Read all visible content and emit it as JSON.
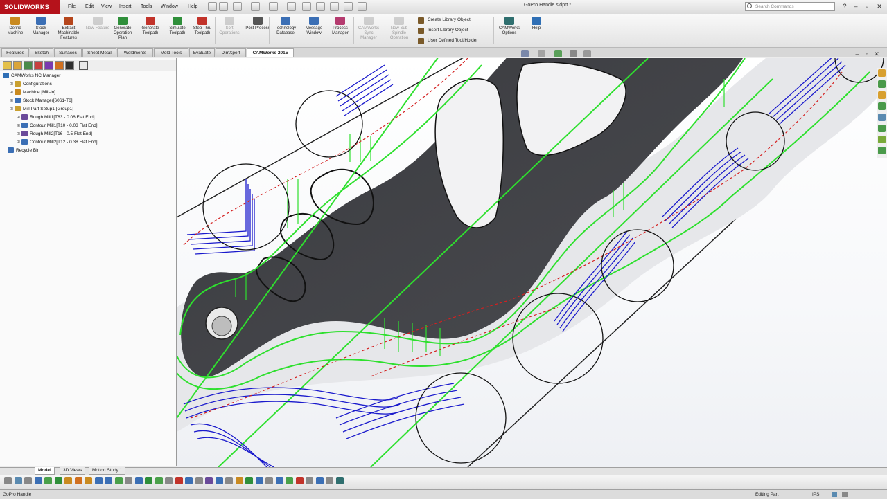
{
  "app": {
    "logo": "SOLIDWORKS",
    "doc_title": "GoPro Handle.sldprt *"
  },
  "menu": [
    "File",
    "Edit",
    "View",
    "Insert",
    "Tools",
    "Window",
    "Help"
  ],
  "search": {
    "placeholder": "Search Commands"
  },
  "window_buttons": [
    "?",
    "–",
    "▫",
    "✕"
  ],
  "commands": [
    {
      "label": "Define Machine",
      "color": "#c98a20",
      "disabled": false
    },
    {
      "label": "Stock Manager",
      "color": "#3b6fb5",
      "disabled": false
    },
    {
      "label": "Extract Machinable Features",
      "color": "#b5451b",
      "disabled": false
    },
    {
      "label": "New Feature",
      "color": "#888888",
      "disabled": true
    },
    {
      "label": "Generate Operation Plan",
      "color": "#2f8f3a",
      "disabled": false
    },
    {
      "label": "Generate Toolpath",
      "color": "#c2332a",
      "disabled": false
    },
    {
      "label": "Simulate Toolpath",
      "color": "#2f8f3a",
      "disabled": false
    },
    {
      "label": "Step Thru Toolpath",
      "color": "#c2332a",
      "disabled": false
    },
    {
      "label": "Sort Operations",
      "color": "#888888",
      "disabled": true
    },
    {
      "label": "Post Process",
      "color": "#555555",
      "disabled": false
    },
    {
      "label": "Technology Database",
      "color": "#3b6fb5",
      "disabled": false
    },
    {
      "label": "Message Window",
      "color": "#3b6fb5",
      "disabled": false
    },
    {
      "label": "Process Manager",
      "color": "#b53b6f",
      "disabled": false
    },
    {
      "label": "CAMWorks Sync Manager",
      "color": "#888888",
      "disabled": true
    },
    {
      "label": "New Sub Spindle Operation",
      "color": "#888888",
      "disabled": true
    }
  ],
  "library": [
    "Create Library Object",
    "Insert Library Object",
    "User Defined Tool/Holder"
  ],
  "commands_right": [
    {
      "label": "CAMWorks Options",
      "color": "#2f6f6f"
    },
    {
      "label": "Help",
      "color": "#2f6fb5"
    }
  ],
  "tabs": [
    {
      "label": "Features",
      "active": false
    },
    {
      "label": "Sketch",
      "active": false
    },
    {
      "label": "Surfaces",
      "active": false
    },
    {
      "label": "Sheet Metal",
      "active": false
    },
    {
      "label": "Weldments",
      "active": false
    },
    {
      "label": "Mold Tools",
      "active": false
    },
    {
      "label": "Evaluate",
      "active": false
    },
    {
      "label": "DimXpert",
      "active": false
    },
    {
      "label": "CAMWorks 2015",
      "active": true
    }
  ],
  "tree": {
    "root": "CAMWorks NC Manager",
    "items": [
      {
        "label": "Configurations",
        "level": 1,
        "color": "#c9a030"
      },
      {
        "label": "Machine [Mill-in]",
        "level": 1,
        "color": "#c98a20"
      },
      {
        "label": "Stock Manager[6061-T6]",
        "level": 1,
        "color": "#3b6fb5"
      },
      {
        "label": "Mill Part Setup1 [Group1]",
        "level": 1,
        "color": "#c9a030"
      },
      {
        "label": "Rough Mill1[T83 - 0.06 Flat End]",
        "level": 2,
        "color": "#6a4a9a"
      },
      {
        "label": "Contour Mill1[T10 - 0.03 Flat End]",
        "level": 2,
        "color": "#3b6fb5"
      },
      {
        "label": "Rough Mill2[T16 - 0.5 Flat End]",
        "level": 2,
        "color": "#6a4a9a"
      },
      {
        "label": "Contour Mill2[T12 - 0.38 Flat End]",
        "level": 2,
        "color": "#3b6fb5"
      },
      {
        "label": "Recycle Bin",
        "level": 0,
        "color": "#3b6fb5"
      }
    ]
  },
  "bottom_tabs": [
    {
      "label": "Model",
      "active": true
    },
    {
      "label": "3D Views",
      "active": false
    },
    {
      "label": "Motion Study 1",
      "active": false
    }
  ],
  "status": {
    "part": "GoPro Handle",
    "state": "Editing Part",
    "units": "IPS"
  }
}
